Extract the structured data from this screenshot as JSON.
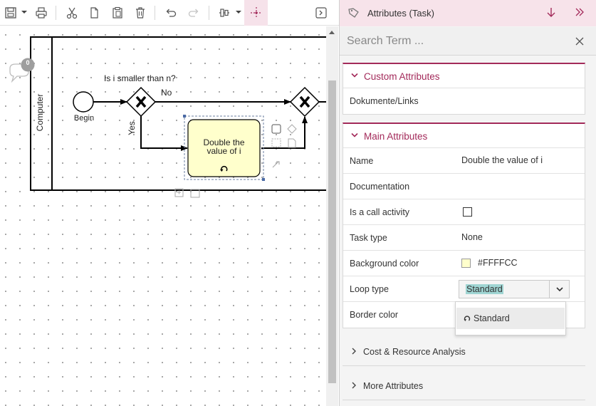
{
  "toolbar": {
    "icons": [
      "save-icon",
      "dropdown-caret",
      "print-icon",
      "cut-icon",
      "copy-icon",
      "paste-icon",
      "delete-icon",
      "undo-icon",
      "redo-icon",
      "align-icon",
      "dropdown-caret",
      "distribute-icon",
      "expand-panel-icon"
    ]
  },
  "diagram": {
    "lane_label": "Computer",
    "comment_count": "0",
    "start_label": "Begin",
    "gateway_question": "Is i smaller than n?",
    "edge_no": "No",
    "edge_yes": "Yes",
    "task_line1": "Double the",
    "task_line2": "value of i",
    "task_fill": "#FFFFCC"
  },
  "panel": {
    "title": "Attributes (Task)",
    "search_placeholder": "Search Term ...",
    "accent": "#a32a5a",
    "custom_section": {
      "title": "Custom Attributes",
      "rows": [
        "Dokumente/Links"
      ]
    },
    "main_section": {
      "title": "Main Attributes",
      "name_label": "Name",
      "name_value": "Double the value of i",
      "documentation_label": "Documentation",
      "call_activity_label": "Is a call activity",
      "call_activity_checked": false,
      "task_type_label": "Task type",
      "task_type_value": "None",
      "background_label": "Background color",
      "background_value": "#FFFFCC",
      "loop_label": "Loop type",
      "loop_value": "Standard",
      "border_label": "Border color"
    },
    "dropdown_option": "Standard",
    "cost_section": "Cost & Resource Analysis",
    "more_section": "More Attributes"
  }
}
